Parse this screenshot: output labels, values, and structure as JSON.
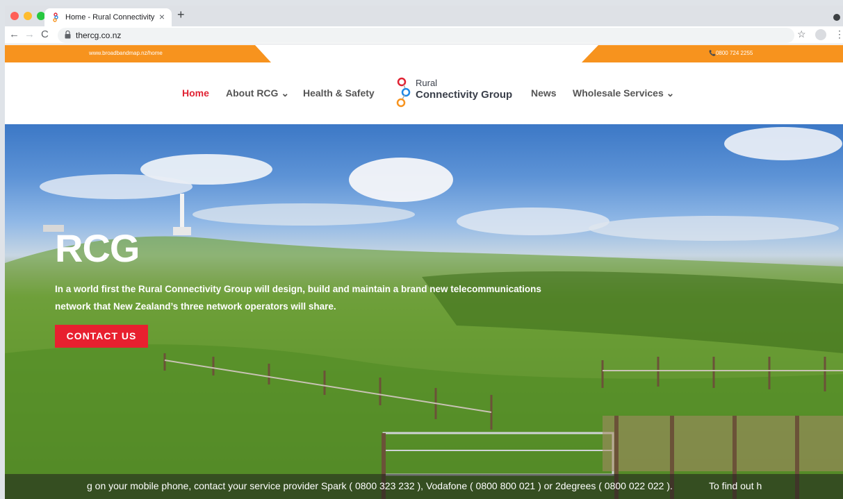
{
  "browser": {
    "tab_title": "Home - Rural Connectivity",
    "url": "thercg.co.nz"
  },
  "topbar": {
    "link_text": "www.broadbandmap.nz/home",
    "phone": "📞0800 724 2255",
    "accent": "#f7931e"
  },
  "nav": {
    "home": "Home",
    "about": "About RCG ⌄",
    "health": "Health & Safety",
    "news": "News",
    "wholesale": "Wholesale Services ⌄"
  },
  "logo": {
    "line1": "Rural",
    "line2": "Connectivity Group"
  },
  "hero": {
    "title": "RCG",
    "description": "In a world first the Rural Connectivity Group will design, build and maintain a brand new telecommunications network that New Zealand’s three network operators will share.",
    "cta": "CONTACT US",
    "cta_color": "#e8202f"
  },
  "ticker": {
    "text": "g on your mobile phone, contact your service provider Spark ( 0800 323 232 ), Vodafone ( 0800 800 021 ) or 2degrees ( 0800 022 022 ).",
    "text2": "To find out h"
  }
}
